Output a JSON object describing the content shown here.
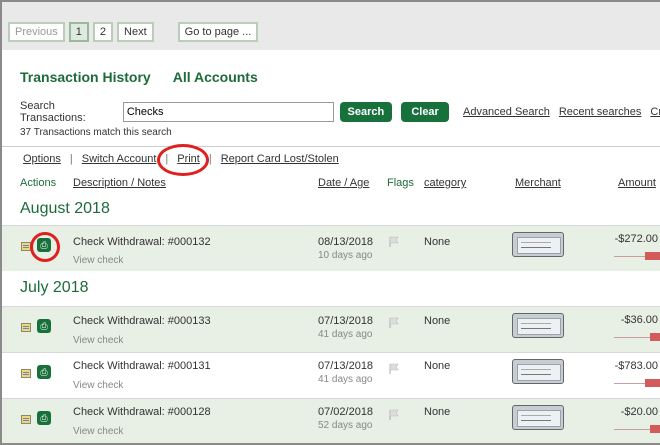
{
  "pagination": {
    "previous": "Previous",
    "pages": [
      "1",
      "2"
    ],
    "next": "Next",
    "goto": "Go to page ..."
  },
  "titles": {
    "history": "Transaction History",
    "accounts": "All Accounts"
  },
  "search": {
    "label": "Search Transactions:",
    "value": "Checks",
    "search_button": "Search",
    "clear_button": "Clear",
    "advanced": "Advanced Search",
    "recent": "Recent searches",
    "create": "Cr",
    "count_text": "37 Transactions match this search"
  },
  "options_bar": {
    "options": "Options",
    "switch_account": "Switch Account",
    "print": "Print",
    "report_card": "Report Card Lost/Stolen",
    "separator": "|"
  },
  "columns": {
    "actions": "Actions",
    "description": "Description / Notes",
    "date": "Date / Age",
    "flags": "Flags",
    "category": "category",
    "merchant": "Merchant",
    "amount": "Amount"
  },
  "groups": [
    {
      "month": "August 2018",
      "transactions": [
        {
          "description": "Check Withdrawal: #000132",
          "sub": "View check",
          "date": "08/13/2018",
          "age": "10 days ago",
          "category": "None",
          "amount": "-$272.00",
          "bar_fraction": 0.35
        }
      ]
    },
    {
      "month": "July 2018",
      "transactions": [
        {
          "description": "Check Withdrawal: #000133",
          "sub": "View check",
          "date": "07/13/2018",
          "age": "41 days ago",
          "category": "None",
          "amount": "-$36.00",
          "bar_fraction": 0.25
        },
        {
          "description": "Check Withdrawal: #000131",
          "sub": "View check",
          "date": "07/13/2018",
          "age": "41 days ago",
          "category": "None",
          "amount": "-$783.00",
          "bar_fraction": 0.35
        },
        {
          "description": "Check Withdrawal: #000128",
          "sub": "View check",
          "date": "07/02/2018",
          "age": "52 days ago",
          "category": "None",
          "amount": "-$20.00",
          "bar_fraction": 0.25
        }
      ]
    }
  ],
  "colors": {
    "brand_green": "#18703b",
    "row_shade": "#e8efe4",
    "annotation_red": "#e02020",
    "amount_bar": "#d25b5b"
  },
  "icons": {
    "note": "note-icon",
    "print": "print-icon",
    "flag": "flag-icon",
    "check_image": "check-image"
  }
}
